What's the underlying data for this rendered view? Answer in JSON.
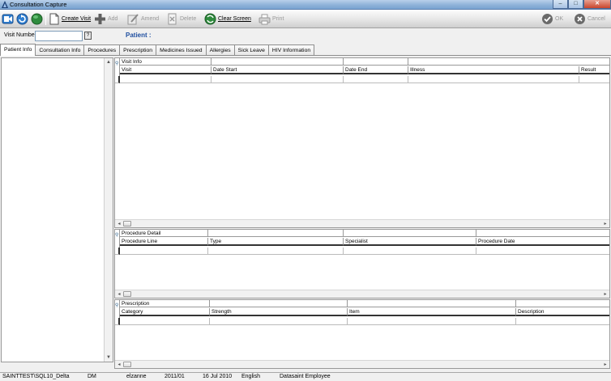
{
  "window": {
    "title": "Consultation Capture"
  },
  "toolbar": {
    "create_visit": "Create Visit",
    "add": "Add",
    "amend": "Amend",
    "delete": "Delete",
    "clear_screen": "Clear Screen",
    "print": "Print",
    "ok": "OK",
    "cancel": "Cancel"
  },
  "visit": {
    "label": "Visit Number",
    "value": "",
    "lookup": "?",
    "patient_label": "Patient :"
  },
  "tabs": [
    "Patient Info",
    "Consultation Info",
    "Procedures",
    "Prescription",
    "Medicines Issued",
    "Allergies",
    "Sick Leave",
    "HIV Information"
  ],
  "grids": {
    "visit": {
      "title": "Visit Info",
      "columns": [
        "Visit",
        "Date Start",
        "Date End",
        "Illness",
        "Result"
      ]
    },
    "procedure": {
      "title": "Procedure Detail",
      "columns": [
        "Procedure Line",
        "Type",
        "Specialist",
        "Procedure Date"
      ]
    },
    "prescription": {
      "title": "Prescription",
      "columns": [
        "Category",
        "Strength",
        "Item",
        "Description"
      ]
    }
  },
  "status": {
    "server": "SAINTTEST\\SQL10_Delta",
    "code": "DM",
    "user": "elzanne",
    "period": "2011/01",
    "date": "16 Jul 2010",
    "language": "English",
    "company": "Datasaint Employee"
  },
  "colors": {
    "accent": "#1f4fa0",
    "titlebar": "#8fb2d9"
  }
}
